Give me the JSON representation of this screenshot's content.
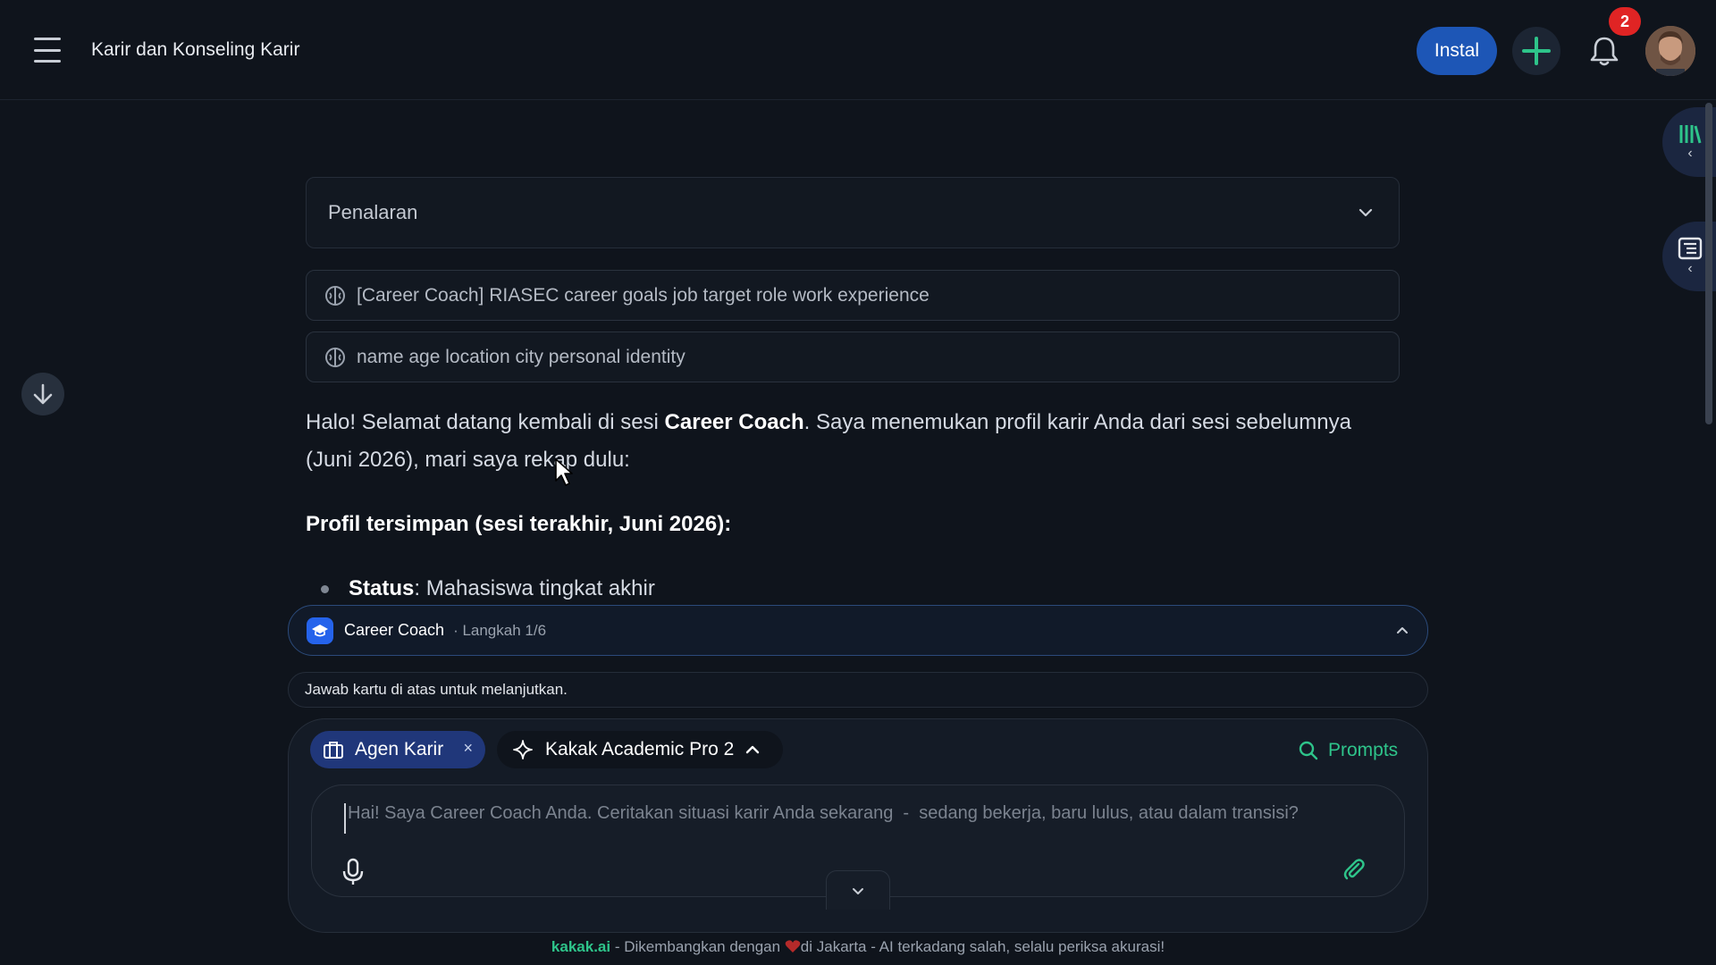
{
  "header": {
    "title": "Karir dan Konseling Karir",
    "install_label": "Instal",
    "notification_count": "2"
  },
  "reasoning": {
    "label": "Penalaran"
  },
  "memories": [
    {
      "text": "[Career Coach] RIASEC career goals job target role work experience"
    },
    {
      "text": "name age location city personal identity"
    }
  ],
  "message": {
    "intro_prefix": "Halo! Selamat datang kembali di sesi ",
    "intro_bold": "Career Coach",
    "intro_suffix": ". Saya menemukan profil karir Anda dari sesi sebelumnya (Juni 2026), mari saya rekap dulu:",
    "heading": "Profil tersimpan (sesi terakhir, Juni 2026):",
    "bullet_key": "Status",
    "bullet_value": ": Mahasiswa tingkat akhir"
  },
  "coach_bar": {
    "name": "Career Coach",
    "step": "· Langkah 1/6"
  },
  "hint": {
    "text": "Jawab kartu di atas untuk melanjutkan."
  },
  "composer": {
    "agent_chip": "Agen Karir",
    "agent_close": "×",
    "model_chip": "Kakak Academic Pro 2",
    "prompts_label": "Prompts",
    "placeholder": "Hai! Saya Career Coach Anda. Ceritakan situasi karir Anda sekarang  -  sedang bekerja, baru lulus, atau dalam transisi?"
  },
  "footer": {
    "brand": "kakak.ai",
    "text_before_heart": " - Dikembangkan dengan ",
    "text_after_heart": "di Jakarta - AI terkadang salah, selalu periksa akurasi!"
  },
  "colors": {
    "background": "#0f141c",
    "accent_blue": "#1d56b6",
    "accent_green": "#2ec48a",
    "badge_red": "#e02424"
  },
  "icons": {
    "menu": "menu-icon",
    "plus": "plus-icon",
    "bell": "bell-icon",
    "library": "library-icon",
    "document": "document-icon",
    "arrow_down": "arrow-down-icon",
    "brain": "brain-icon",
    "graduation": "graduation-cap-icon",
    "briefcase": "briefcase-icon",
    "sparkle": "sparkle-icon",
    "search": "search-icon",
    "mic": "mic-icon",
    "paperclip": "paperclip-icon",
    "heart": "heart-icon"
  }
}
